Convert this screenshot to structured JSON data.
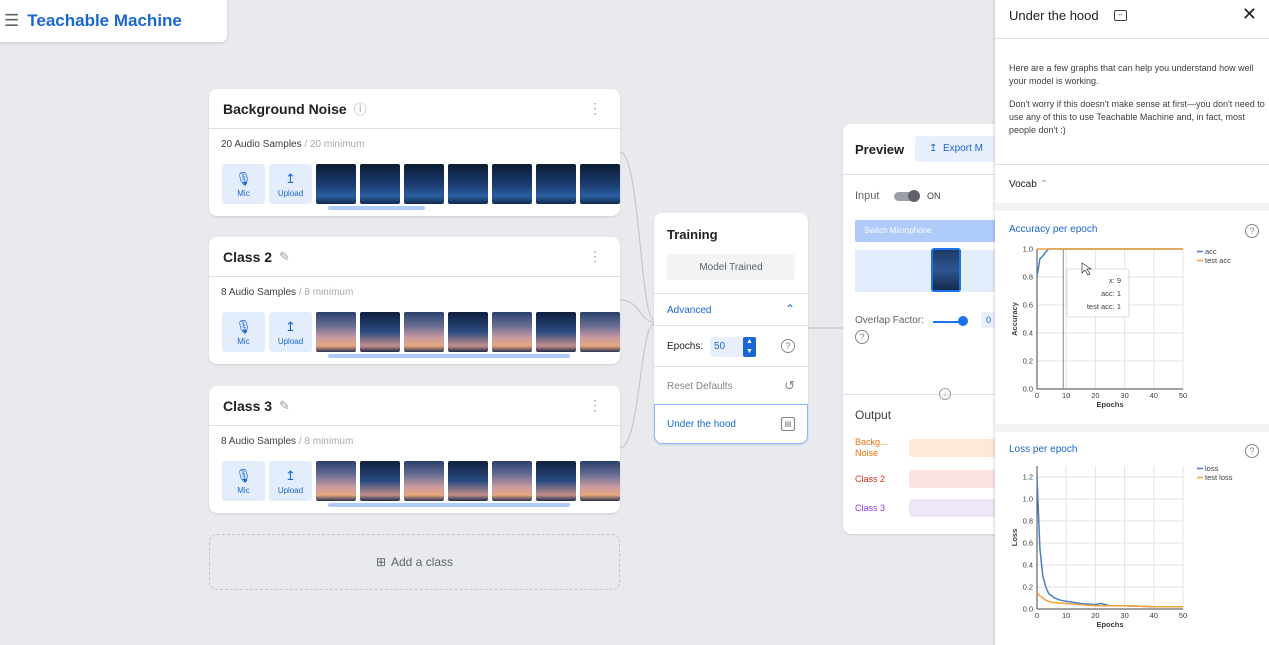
{
  "app": {
    "title": "Teachable Machine"
  },
  "classes": [
    {
      "name": "Background Noise",
      "samples": "20 Audio Samples",
      "minimum": "/ 20 minimum",
      "edit_icon": "help-circle-icon"
    },
    {
      "name": "Class 2",
      "samples": "8 Audio Samples",
      "minimum": "/ 8 minimum",
      "edit_icon": "pencil-icon"
    },
    {
      "name": "Class 3",
      "samples": "8 Audio Samples",
      "minimum": "/ 8 minimum",
      "edit_icon": "pencil-icon"
    }
  ],
  "tools": {
    "mic": "Mic",
    "upload": "Upload"
  },
  "add_class": "Add a class",
  "training": {
    "title": "Training",
    "status": "Model Trained",
    "advanced": "Advanced",
    "epochs_label": "Epochs:",
    "epochs_value": "50",
    "reset": "Reset Defaults",
    "under_the_hood": "Under the hood"
  },
  "preview": {
    "title": "Preview",
    "export": "Export M",
    "input_label": "Input",
    "toggle_state": "ON",
    "switch_mic": "Switch Microphone",
    "overlap_label": "Overlap Factor:",
    "overlap_value": "0",
    "output_label": "Output",
    "outputs": [
      {
        "label": "Backg... Noise",
        "color": "#e8710a",
        "bar": "#fde8d9"
      },
      {
        "label": "Class 2",
        "color": "#d93025",
        "bar": "#fce3e2"
      },
      {
        "label": "Class 3",
        "color": "#9334e6",
        "bar": "#ede7f6"
      }
    ]
  },
  "panel": {
    "title": "Under the hood",
    "intro1": "Here are a few graphs that can help you understand how well your model is working.",
    "intro2": "Don't worry if this doesn't make sense at first—you don't need to use any of this to use Teachable Machine and, in fact, most people don't :)",
    "vocab": "Vocab",
    "accuracy_title": "Accuracy per epoch",
    "loss_title": "Loss per epoch"
  },
  "colors": {
    "accent": "#1967d2",
    "series_blue": "#4a7fc1",
    "series_orange": "#f2a33a"
  },
  "chart_data": [
    {
      "type": "line",
      "title": "Accuracy per epoch",
      "xlabel": "Epochs",
      "ylabel": "Accuracy",
      "xlim": [
        0,
        50
      ],
      "ylim": [
        0,
        1.0
      ],
      "xticks": [
        "0",
        "10",
        "20",
        "30",
        "40",
        "50"
      ],
      "yticks": [
        "0.0",
        "0.2",
        "0.4",
        "0.6",
        "0.8",
        "1.0"
      ],
      "legend": "top-right",
      "grid": true,
      "series": [
        {
          "name": "acc",
          "x": [
            0,
            1,
            2,
            3,
            4,
            5,
            10,
            20,
            30,
            40,
            50
          ],
          "y": [
            0.8,
            0.93,
            0.95,
            0.98,
            1.0,
            1.0,
            1.0,
            1.0,
            1.0,
            1.0,
            1.0
          ]
        },
        {
          "name": "test acc",
          "x": [
            0,
            1,
            2,
            3,
            5,
            10,
            20,
            30,
            40,
            50
          ],
          "y": [
            1.0,
            1.0,
            1.0,
            1.0,
            1.0,
            1.0,
            1.0,
            1.0,
            1.0,
            1.0
          ]
        }
      ],
      "tooltip": {
        "x_label": "x:",
        "x": "9",
        "acc_label": "acc:",
        "acc": "1",
        "test_label": "test acc:",
        "test": "1"
      }
    },
    {
      "type": "line",
      "title": "Loss per epoch",
      "xlabel": "Epochs",
      "ylabel": "Loss",
      "xlim": [
        0,
        50
      ],
      "ylim": [
        0,
        1.3
      ],
      "xticks": [
        "0",
        "10",
        "20",
        "30",
        "40",
        "50"
      ],
      "yticks": [
        "0.0",
        "0.2",
        "0.4",
        "0.6",
        "0.8",
        "1.0",
        "1.2"
      ],
      "legend": "top-right",
      "grid": true,
      "series": [
        {
          "name": "loss",
          "x": [
            0,
            1,
            2,
            3,
            4,
            6,
            8,
            10,
            15,
            20,
            22,
            25,
            30,
            40,
            50
          ],
          "y": [
            1.2,
            0.55,
            0.3,
            0.2,
            0.14,
            0.1,
            0.08,
            0.07,
            0.05,
            0.04,
            0.05,
            0.03,
            0.03,
            0.02,
            0.02
          ]
        },
        {
          "name": "test loss",
          "x": [
            0,
            1,
            2,
            3,
            5,
            10,
            20,
            30,
            40,
            50
          ],
          "y": [
            0.15,
            0.12,
            0.1,
            0.08,
            0.06,
            0.05,
            0.03,
            0.03,
            0.02,
            0.02
          ]
        }
      ]
    }
  ]
}
